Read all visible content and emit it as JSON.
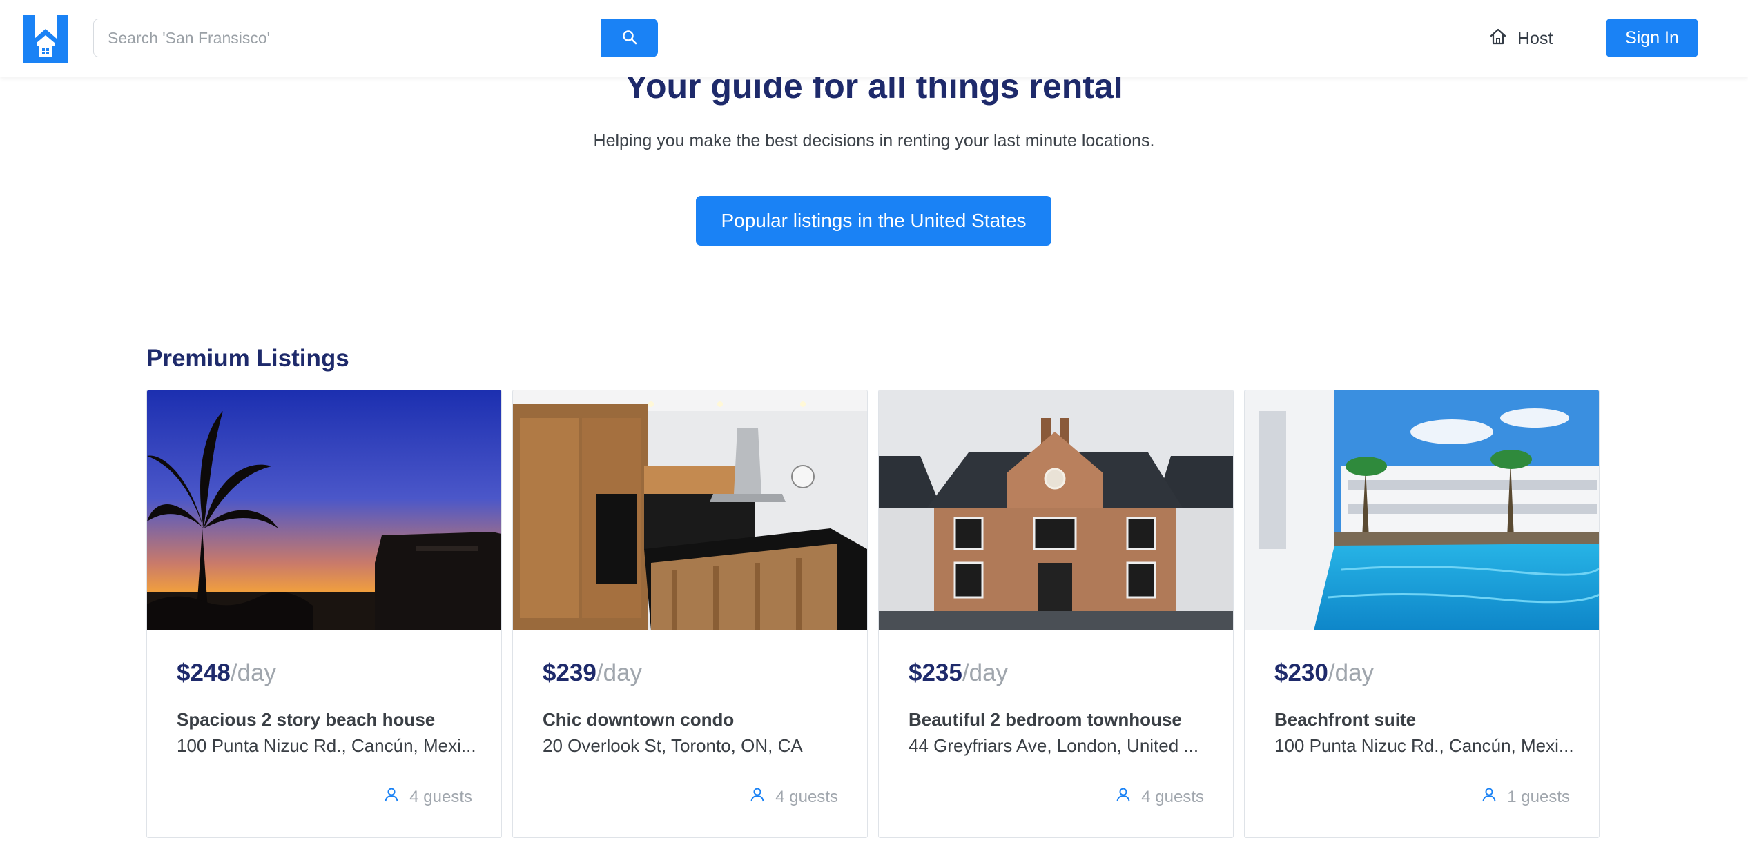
{
  "header": {
    "logo_icon": "house-h-logo-icon",
    "search_placeholder": "Search 'San Fransisco'",
    "search_icon": "search-icon",
    "host_icon": "home-icon",
    "host_label": "Host",
    "signin_label": "Sign In"
  },
  "hero": {
    "title": "Your guide for all things rental",
    "subtitle": "Helping you make the best decisions in renting your last minute locations.",
    "cta_label": "Popular listings in the United States"
  },
  "premium": {
    "heading": "Premium Listings",
    "listings": [
      {
        "price": "$248",
        "per": "/day",
        "title": "Spacious 2 story beach house",
        "address": "100 Punta Nizuc Rd., Cancún, Mexi...",
        "guests": "4 guests",
        "image": "beach-sunset-palm"
      },
      {
        "price": "$239",
        "per": "/day",
        "title": "Chic downtown condo",
        "address": "20 Overlook St, Toronto, ON, CA",
        "guests": "4 guests",
        "image": "modern-kitchen"
      },
      {
        "price": "$235",
        "per": "/day",
        "title": "Beautiful 2 bedroom townhouse",
        "address": "44 Greyfriars Ave, London, United ...",
        "guests": "4 guests",
        "image": "brick-townhouse"
      },
      {
        "price": "$230",
        "per": "/day",
        "title": "Beachfront suite",
        "address": "100 Punta Nizuc Rd., Cancún, Mexi...",
        "guests": "1 guests",
        "image": "resort-pool"
      }
    ]
  },
  "colors": {
    "brand_blue": "#1a82f5",
    "heading_navy": "#1e2a6b",
    "muted_gray": "#a0a6ad"
  }
}
